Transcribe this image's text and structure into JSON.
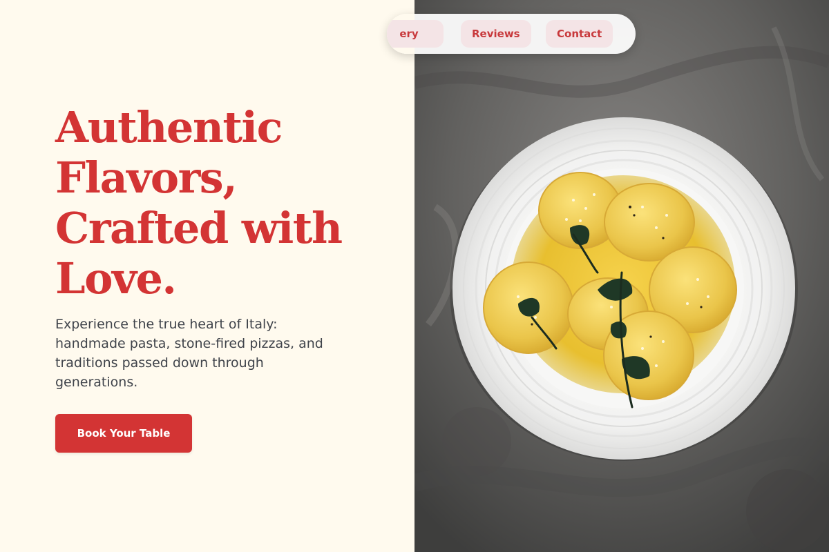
{
  "hero": {
    "title_lines": [
      "Authentic",
      "Flavors,",
      "Crafted with",
      "Love."
    ],
    "description": "Experience the true heart of Italy: handmade pasta, stone-fired pizzas, and traditions passed down through generations.",
    "cta_label": "Book Your Table"
  },
  "nav": {
    "items": [
      {
        "label": "ery"
      },
      {
        "label": "Reviews"
      },
      {
        "label": "Contact"
      }
    ]
  },
  "image": {
    "subject": "plate of ravioli with sage and parmesan on a dark stone surface"
  },
  "colors": {
    "brand_red": "#d33434",
    "background_cream": "#fffaee",
    "text_dark": "#3f434a",
    "nav_chip": "#f4e4e6",
    "stone_gray": "#5b5a58",
    "pasta_yellow": "#edc94a",
    "plate_white": "#f3f3f2"
  },
  "icons": [
    "sage-leaf-icon"
  ]
}
